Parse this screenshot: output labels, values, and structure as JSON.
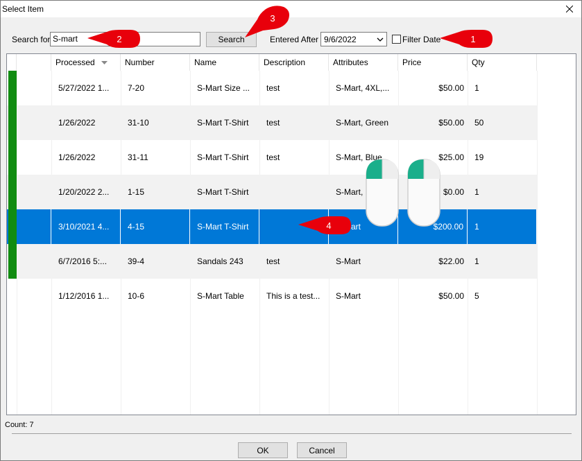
{
  "window": {
    "title": "Select Item"
  },
  "search": {
    "label": "Search for",
    "value": "S-mart",
    "button": "Search"
  },
  "entered_after": {
    "label": "Entered After",
    "value": "9/6/2022"
  },
  "filter_date": {
    "label": "Filter Date",
    "checked": false
  },
  "columns": [
    "Processed",
    "Number",
    "Name",
    "Description",
    "Attributes",
    "Price",
    "Qty"
  ],
  "rows": [
    {
      "processed": "5/27/2022 1...",
      "number": "7-20",
      "name": "S-Mart Size ...",
      "description": "test",
      "attributes": "S-Mart, 4XL,...",
      "price": "$50.00",
      "qty": "1"
    },
    {
      "processed": "1/26/2022",
      "number": "31-10",
      "name": "S-Mart T-Shirt",
      "description": "test",
      "attributes": "S-Mart, Green",
      "price": "$50.00",
      "qty": "50"
    },
    {
      "processed": "1/26/2022",
      "number": "31-11",
      "name": "S-Mart T-Shirt",
      "description": "test",
      "attributes": "S-Mart, Blue",
      "price": "$25.00",
      "qty": "19"
    },
    {
      "processed": "1/20/2022 2...",
      "number": "1-15",
      "name": "S-Mart T-Shirt",
      "description": "",
      "attributes": "S-Mart,",
      "price": "$0.00",
      "qty": "1"
    },
    {
      "processed": "3/10/2021 4...",
      "number": "4-15",
      "name": "S-Mart T-Shirt",
      "description": "",
      "attributes": "S-Mart",
      "price": "$200.00",
      "qty": "1"
    },
    {
      "processed": "6/7/2016 5:...",
      "number": "39-4",
      "name": "Sandals 243",
      "description": "test",
      "attributes": "S-Mart",
      "price": "$22.00",
      "qty": "1"
    },
    {
      "processed": "1/12/2016 1...",
      "number": "10-6",
      "name": "S-Mart Table",
      "description": "This is a test...",
      "attributes": "S-Mart",
      "price": "$50.00",
      "qty": "5"
    }
  ],
  "status": {
    "count": "Count: 7"
  },
  "buttons": {
    "ok": "OK",
    "cancel": "Cancel"
  },
  "callouts": [
    "1",
    "2",
    "3",
    "4"
  ],
  "colors": {
    "selection": "#0078d7",
    "marker": "#118c11",
    "callout": "#e8000b",
    "mouse_accent": "#1aaf8b"
  }
}
